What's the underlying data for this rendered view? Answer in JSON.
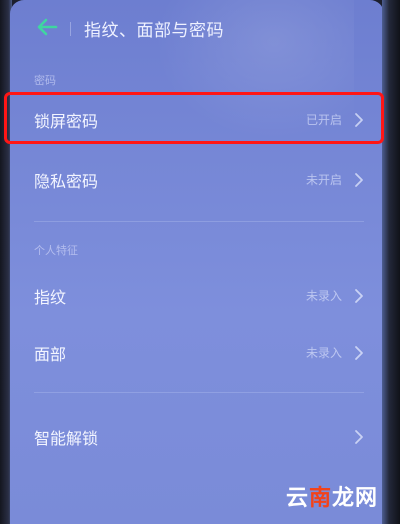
{
  "header": {
    "title": "指纹、面部与密码"
  },
  "sections": [
    {
      "label": "密码",
      "items": [
        {
          "label": "锁屏密码",
          "value": "已开启"
        },
        {
          "label": "隐私密码",
          "value": "未开启"
        }
      ]
    },
    {
      "label": "个人特征",
      "items": [
        {
          "label": "指纹",
          "value": "未录入"
        },
        {
          "label": "面部",
          "value": "未录入"
        }
      ]
    },
    {
      "label": "",
      "items": [
        {
          "label": "智能解锁",
          "value": ""
        }
      ]
    }
  ],
  "watermark": {
    "part1": "云",
    "part2": "南",
    "part3": "龙网"
  },
  "colors": {
    "highlight": "#ff1616",
    "accent_back": "#3fd6a0",
    "screen_bg": "#7687d6"
  },
  "icons": {
    "back": "arrow-left-icon",
    "chevron": "chevron-right-icon"
  }
}
